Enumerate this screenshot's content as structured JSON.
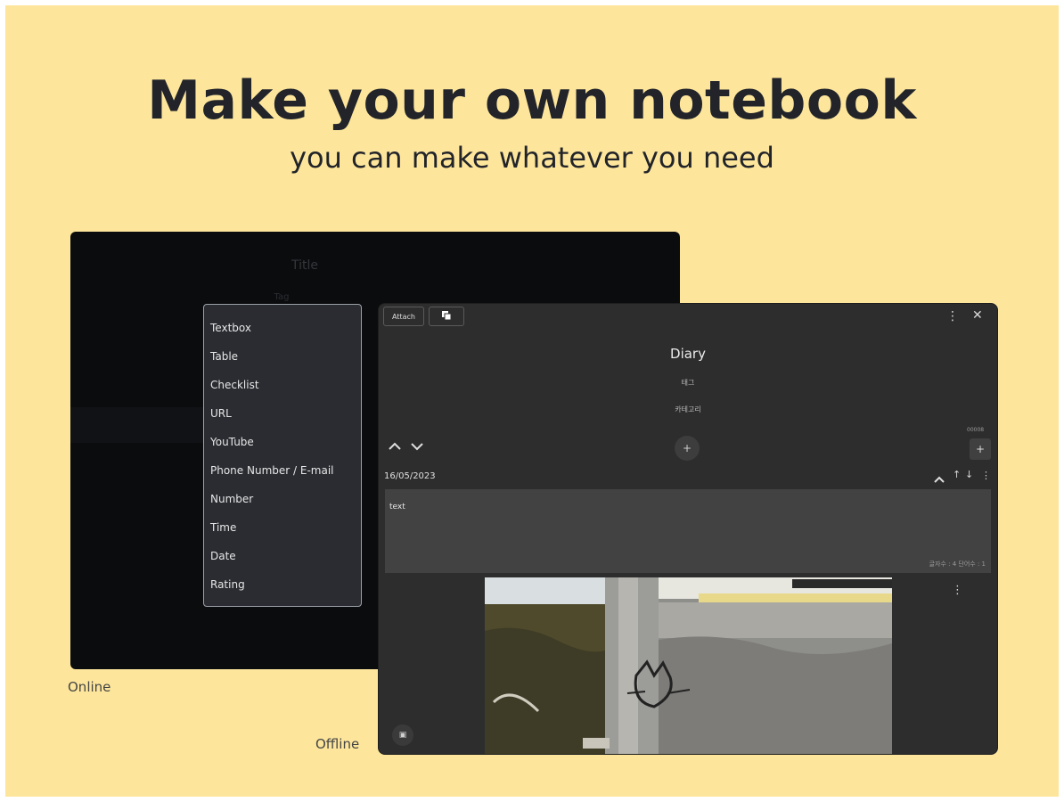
{
  "poster": {
    "headline": "Make your own notebook",
    "subline": "you can make whatever you need",
    "caption_online": "Online",
    "caption_offline": "Offline",
    "background": "#fde69c"
  },
  "online_window": {
    "title": "Title",
    "tag": "Tag",
    "menu_items": [
      "Textbox",
      "Table",
      "Checklist",
      "URL",
      "YouTube",
      "Phone Number / E-mail",
      "Number",
      "Time",
      "Date",
      "Rating"
    ]
  },
  "offline_window": {
    "toolbar": {
      "button1_label": "Attach",
      "copy_icon": "copy-icon",
      "more_icon": "more-vertical-icon",
      "close_icon": "close-icon"
    },
    "title": "Diary",
    "tag": "태그",
    "category": "카테고리",
    "sort_up_icon": "chevron-up-icon",
    "sort_down_icon": "chevron-down-icon",
    "add_label": "+",
    "small_label": "00008",
    "entry": {
      "date": "16/05/2023",
      "text": "text",
      "counter": "글자수 : 4   단어수 : 1"
    }
  }
}
